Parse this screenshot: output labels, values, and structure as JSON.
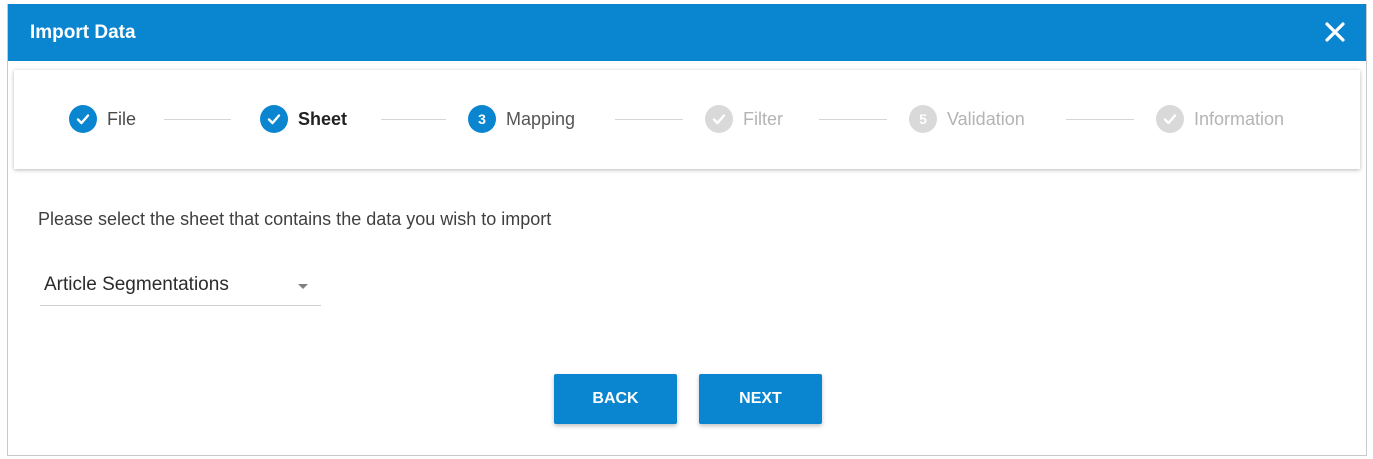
{
  "dialog": {
    "title": "Import Data",
    "close_icon": "close-icon",
    "header_color": "#0a86d0"
  },
  "steps": [
    {
      "label": "File",
      "state": "done",
      "icon": "check-icon"
    },
    {
      "label": "Sheet",
      "state": "done",
      "icon": "check-icon"
    },
    {
      "label": "Mapping",
      "state": "current",
      "number": "3"
    },
    {
      "label": "Filter",
      "state": "pending",
      "icon": "check-icon"
    },
    {
      "label": "Validation",
      "state": "pending",
      "number": "5"
    },
    {
      "label": "Information",
      "state": "pending",
      "icon": "check-icon"
    }
  ],
  "main": {
    "instruction": "Please select the sheet that contains the data you wish to import",
    "sheet_select": {
      "value": "Article Segmentations",
      "icon": "dropdown-arrow-icon"
    }
  },
  "buttons": {
    "back_label": "BACK",
    "next_label": "NEXT"
  }
}
